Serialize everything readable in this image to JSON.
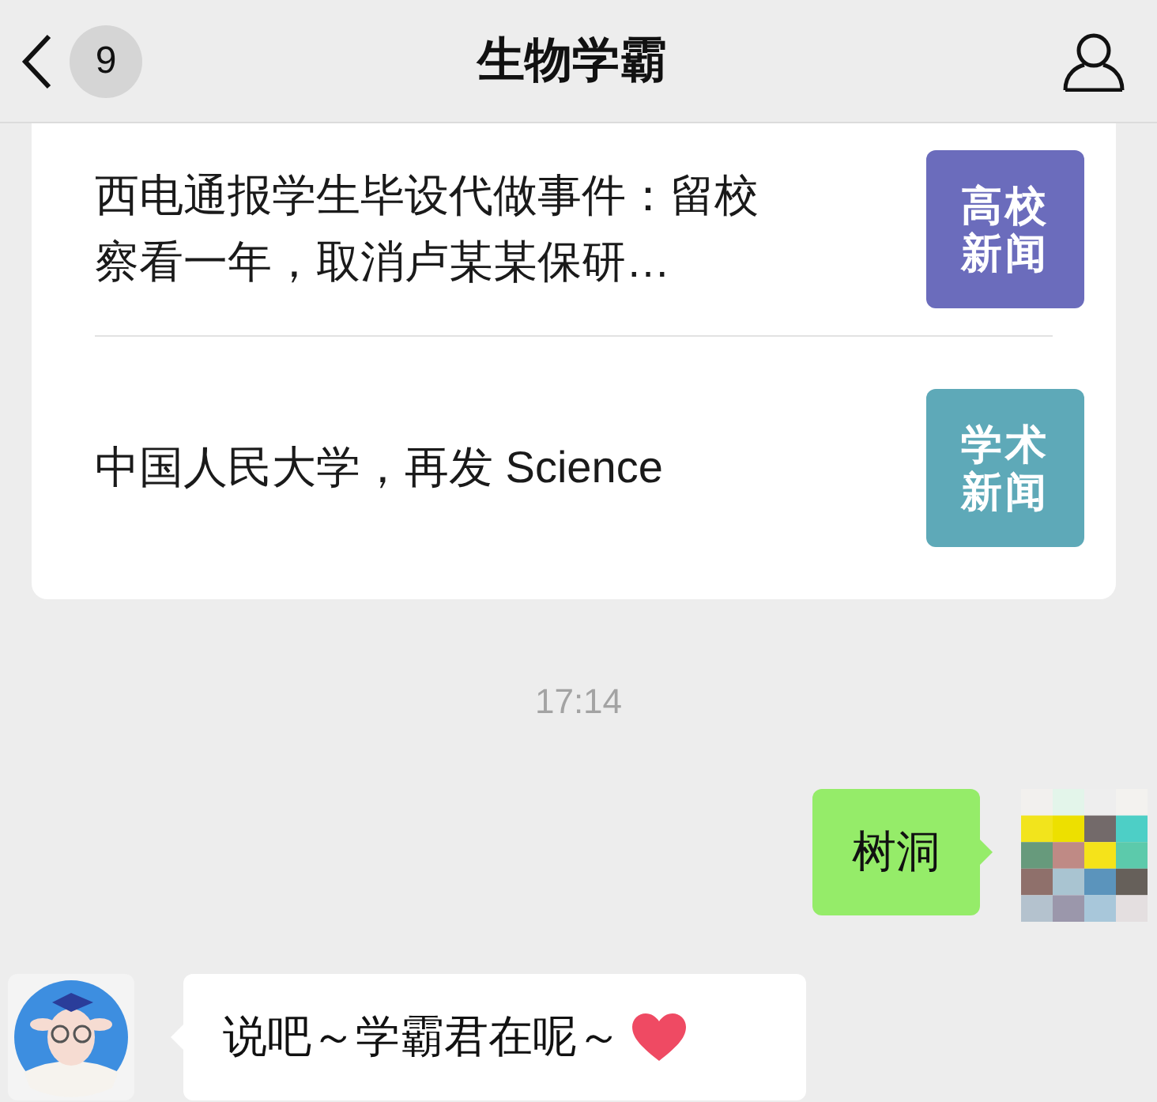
{
  "header": {
    "unread_count": "9",
    "title": "生物学霸"
  },
  "news": [
    {
      "title": "西电通报学生毕设代做事件：留校察看一年，取消卢某某保研…",
      "thumbnail": {
        "lines": [
          "高校",
          "新闻"
        ],
        "color": "#6b6cbc"
      }
    },
    {
      "title": "中国人民大学，再发 Science",
      "thumbnail": {
        "lines": [
          "学术",
          "新闻"
        ],
        "color": "#5ea9b8"
      }
    }
  ],
  "messages": [
    {
      "kind": "time",
      "text": "17:14"
    },
    {
      "kind": "sent",
      "text": "树洞"
    },
    {
      "kind": "received",
      "text": "说吧～学霸君在呢～"
    }
  ]
}
